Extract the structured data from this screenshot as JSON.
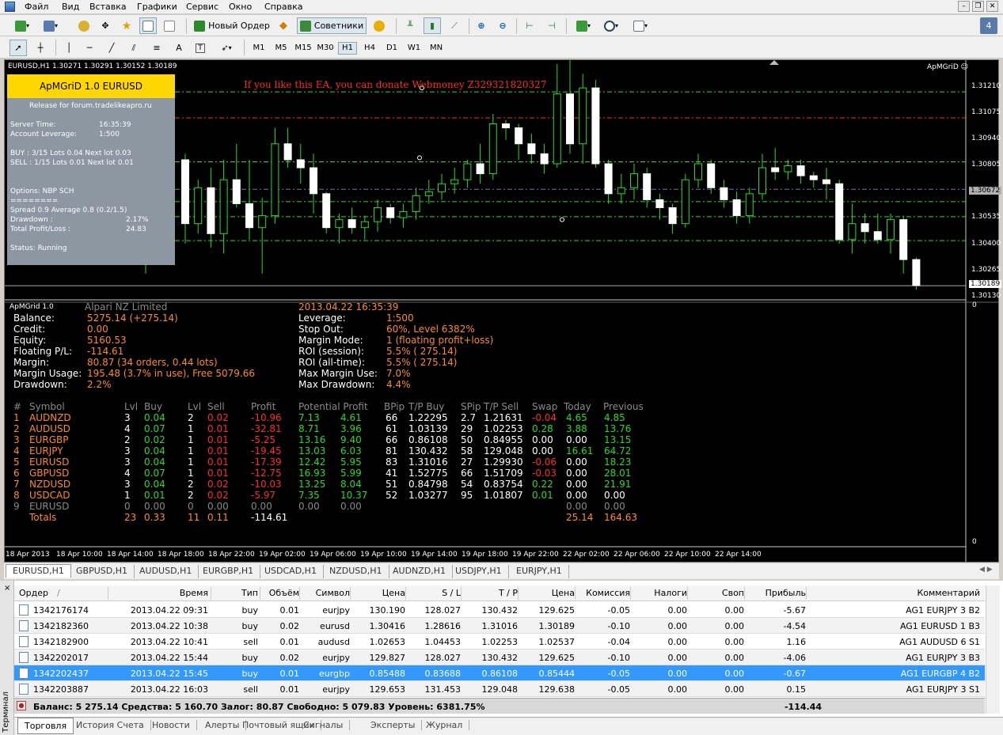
{
  "menu": {
    "items": [
      "Файл",
      "Вид",
      "Вставка",
      "Графики",
      "Сервис",
      "Окно",
      "Справка"
    ]
  },
  "toolbar": {
    "new_order": "Новый Ордер",
    "advisors": "Советники",
    "notify_count": "4",
    "timeframes": [
      "M1",
      "M5",
      "M15",
      "M30",
      "H1",
      "H4",
      "D1",
      "W1",
      "MN"
    ],
    "active_tf": "H1",
    "text_tool": "A",
    "label_tool": "T"
  },
  "chart": {
    "label": "EURUSD,H1  1.30271 1.30291 1.30152 1.30189",
    "brand": "ApMGriD ☺",
    "donate": "If you like this EA, you can donate Webmoney Z329321820327",
    "price_axis": [
      "1.31210",
      "1.31075",
      "1.30940",
      "1.30805",
      "1.30672",
      "1.30535",
      "1.30400",
      "1.30265",
      "1.30189",
      "1.30130"
    ],
    "current_price": "1.30672",
    "last_price": "1.30189",
    "time_axis": [
      "18 Apr 2013",
      "18 Apr 10:00",
      "18 Apr 14:00",
      "18 Apr 18:00",
      "18 Apr 22:00",
      "19 Apr 02:00",
      "19 Apr 06:00",
      "19 Apr 10:00",
      "19 Apr 14:00",
      "19 Apr 18:00",
      "19 Apr 22:00",
      "22 Apr 02:00",
      "22 Apr 06:00",
      "22 Apr 10:00",
      "22 Apr 14:00"
    ],
    "sub_axis_top": "0",
    "sub_axis_bottom": "0",
    "candles": [
      [
        1.3082,
        1.3085,
        1.304,
        1.305
      ],
      [
        1.305,
        1.3072,
        1.3045,
        1.3068
      ],
      [
        1.3068,
        1.3078,
        1.3038,
        1.3045
      ],
      [
        1.3045,
        1.3082,
        1.3035,
        1.3072
      ],
      [
        1.3072,
        1.309,
        1.3058,
        1.306
      ],
      [
        1.306,
        1.3082,
        1.3042,
        1.3048
      ],
      [
        1.3048,
        1.3063,
        1.3025,
        1.3054
      ],
      [
        1.3054,
        1.3098,
        1.305,
        1.309
      ],
      [
        1.309,
        1.3098,
        1.3078,
        1.3082
      ],
      [
        1.3082,
        1.309,
        1.307,
        1.3078
      ],
      [
        1.3078,
        1.3085,
        1.3055,
        1.3065
      ],
      [
        1.3065,
        1.3066,
        1.3045,
        1.3048
      ],
      [
        1.3048,
        1.3055,
        1.304,
        1.3052
      ],
      [
        1.3052,
        1.3058,
        1.3045,
        1.3048
      ],
      [
        1.3048,
        1.3054,
        1.3042,
        1.3051
      ],
      [
        1.3051,
        1.3062,
        1.3046,
        1.3058
      ],
      [
        1.3058,
        1.306,
        1.305,
        1.3053
      ],
      [
        1.3053,
        1.306,
        1.3048,
        1.3056
      ],
      [
        1.3056,
        1.3068,
        1.3052,
        1.3064
      ],
      [
        1.3064,
        1.3072,
        1.306,
        1.3066
      ],
      [
        1.3066,
        1.3075,
        1.3062,
        1.307
      ],
      [
        1.307,
        1.3078,
        1.3065,
        1.3072
      ],
      [
        1.3072,
        1.3082,
        1.3068,
        1.308
      ],
      [
        1.308,
        1.309,
        1.307,
        1.3075
      ],
      [
        1.3075,
        1.3105,
        1.3072,
        1.31
      ],
      [
        1.31,
        1.3102,
        1.3092,
        1.3098
      ],
      [
        1.3098,
        1.31,
        1.3082,
        1.309
      ],
      [
        1.309,
        1.3095,
        1.308,
        1.3085
      ],
      [
        1.3085,
        1.309,
        1.3075,
        1.308
      ],
      [
        1.308,
        1.313,
        1.3078,
        1.3115
      ],
      [
        1.3115,
        1.3135,
        1.3085,
        1.309
      ],
      [
        1.309,
        1.3125,
        1.308,
        1.3118
      ],
      [
        1.3118,
        1.3122,
        1.3078,
        1.308
      ],
      [
        1.308,
        1.3082,
        1.306,
        1.3065
      ],
      [
        1.3065,
        1.3075,
        1.306,
        1.3068
      ],
      [
        1.3068,
        1.308,
        1.3062,
        1.3075
      ],
      [
        1.3075,
        1.3078,
        1.3058,
        1.3062
      ],
      [
        1.3062,
        1.3065,
        1.3052,
        1.3058
      ],
      [
        1.3058,
        1.306,
        1.3045,
        1.305
      ],
      [
        1.305,
        1.3075,
        1.3048,
        1.3072
      ],
      [
        1.3072,
        1.3085,
        1.3068,
        1.308
      ],
      [
        1.308,
        1.3082,
        1.3065,
        1.3068
      ],
      [
        1.3068,
        1.3072,
        1.3058,
        1.3062
      ],
      [
        1.3062,
        1.3066,
        1.305,
        1.3054
      ],
      [
        1.3054,
        1.3068,
        1.305,
        1.3065
      ],
      [
        1.3065,
        1.3085,
        1.3062,
        1.3078
      ],
      [
        1.3078,
        1.3088,
        1.3072,
        1.3076
      ],
      [
        1.3076,
        1.3082,
        1.3072,
        1.3079
      ],
      [
        1.3079,
        1.3082,
        1.307,
        1.3074
      ],
      [
        1.3074,
        1.3076,
        1.3068,
        1.3072
      ],
      [
        1.3072,
        1.3078,
        1.3062,
        1.307
      ],
      [
        1.307,
        1.3072,
        1.304,
        1.3042
      ],
      [
        1.3042,
        1.306,
        1.3035,
        1.305
      ],
      [
        1.305,
        1.3055,
        1.304,
        1.3046
      ],
      [
        1.3046,
        1.3055,
        1.304,
        1.3042
      ],
      [
        1.3042,
        1.3055,
        1.3035,
        1.3052
      ],
      [
        1.3052,
        1.3054,
        1.3025,
        1.3032
      ],
      [
        1.3032,
        1.3033,
        1.3017,
        1.3019
      ]
    ],
    "levels": [
      {
        "price": 1.3116,
        "color": "#22dd22",
        "style": "dash-dot"
      },
      {
        "price": 1.3103,
        "color": "#ff2a2a",
        "style": "dash-dot"
      },
      {
        "price": 1.3081,
        "color": "#22dd22",
        "style": "dash-dot"
      },
      {
        "price": 1.30672,
        "color": "#6677aa",
        "style": "dash-dot"
      },
      {
        "price": 1.3061,
        "color": "#22dd22",
        "style": "dash-dot"
      },
      {
        "price": 1.30535,
        "color": "#22dd22",
        "style": "dash-dot"
      },
      {
        "price": 1.30415,
        "color": "#22dd22",
        "style": "dash-dot"
      },
      {
        "price": 1.30189,
        "color": "#aaaaaa",
        "style": "solid"
      }
    ],
    "price_min": 1.3013,
    "price_max": 1.3124
  },
  "ea_panel": {
    "title": "ApMGriD 1.0 EURUSD",
    "release": "Release for forum.tradelikeapro.ru",
    "server_time_label": "Server Time:",
    "server_time": "16:35:39",
    "leverage_label": "Account Leverage:",
    "leverage": "1:500",
    "buy_line": "BUY : 3/15  Lots 0.04 Next lot 0.03",
    "sell_line": "SELL : 1/15  Lots 0.01 Next lot 0.01",
    "options": "Options: NBP SCH",
    "divider": "========",
    "spread": "Spread 0.9 Average 0.8 (0.2/1.5)",
    "drawdown_label": "Drawdown :",
    "drawdown": "2.17%",
    "pl_label": "Total Profit/Loss :",
    "pl": "24.83",
    "status": "Status: Running"
  },
  "stats": {
    "ea_name": "ApMGrid 1.0",
    "broker": "Alpari NZ Limited",
    "datetime": "2013.04.22 16:35:39",
    "left": [
      [
        "Balance:",
        "5275.14 (+275.14)"
      ],
      [
        "Credit:",
        "0.00"
      ],
      [
        "Equity:",
        "5160.53"
      ],
      [
        "Floating P/L:",
        "-114.61"
      ],
      [
        "Margin:",
        "80.87 (34 orders, 0.44 lots)"
      ],
      [
        "Margin Usage:",
        "195.48 (3.7% in use), Free 5079.66"
      ],
      [
        "Drawdown:",
        "2.2%"
      ]
    ],
    "right": [
      [
        "Leverage:",
        "1:500"
      ],
      [
        "Stop Out:",
        "60%, Level 6382%"
      ],
      [
        "Margin Mode:",
        "1 (floating profit+loss)"
      ],
      [
        "ROI (session):",
        "5.5% ( 275.14)"
      ],
      [
        "ROI (all-time):",
        "5.5% ( 275.14)"
      ],
      [
        "Max Margin Use:",
        "7.0%"
      ],
      [
        "Max Drawdown:",
        "4.4%"
      ]
    ]
  },
  "symtable": {
    "headers": [
      "#",
      "Symbol",
      "Lvl",
      "Buy",
      "Lvl",
      "Sell",
      "Profit",
      "Potential Profit",
      "BPip",
      "T/P Buy",
      "SPip",
      "T/P Sell",
      "Swap",
      "Today",
      "Previous"
    ],
    "rows": [
      [
        "1",
        "AUDNZD",
        "3",
        "0.04",
        "2",
        "0.02",
        "-10.96",
        "7.13",
        "4.61",
        "66",
        "1.22295",
        "2.7",
        "1.21631",
        "-0.04",
        "4.65",
        "4.85"
      ],
      [
        "2",
        "AUDUSD",
        "4",
        "0.07",
        "1",
        "0.01",
        "-32.81",
        "8.71",
        "3.96",
        "61",
        "1.03139",
        "29",
        "1.02253",
        "0.28",
        "3.88",
        "13.76"
      ],
      [
        "3",
        "EURGBP",
        "2",
        "0.02",
        "1",
        "0.01",
        "-5.25",
        "13.16",
        "9.40",
        "66",
        "0.86108",
        "50",
        "0.84955",
        "0.00",
        "0.00",
        "13.15"
      ],
      [
        "4",
        "EURJPY",
        "3",
        "0.04",
        "1",
        "0.01",
        "-19.45",
        "13.03",
        "6.03",
        "81",
        "130.432",
        "58",
        "129.048",
        "0.00",
        "16.61",
        "64.72"
      ],
      [
        "5",
        "EURUSD",
        "3",
        "0.04",
        "1",
        "0.01",
        "-17.39",
        "12.42",
        "5.95",
        "83",
        "1.31016",
        "27",
        "1.29930",
        "-0.06",
        "0.00",
        "18.23"
      ],
      [
        "6",
        "GBPUSD",
        "4",
        "0.07",
        "1",
        "0.01",
        "-12.75",
        "16.93",
        "5.99",
        "41",
        "1.52775",
        "66",
        "1.51709",
        "-0.03",
        "0.00",
        "28.01"
      ],
      [
        "7",
        "NZDUSD",
        "3",
        "0.04",
        "2",
        "0.02",
        "-10.03",
        "13.25",
        "8.04",
        "51",
        "0.84798",
        "54",
        "0.83754",
        "0.22",
        "0.00",
        "21.91"
      ],
      [
        "8",
        "USDCAD",
        "1",
        "0.01",
        "2",
        "0.02",
        "-5.97",
        "7.35",
        "10.37",
        "52",
        "1.03277",
        "95",
        "1.01807",
        "0.01",
        "0.00",
        "0.00"
      ],
      [
        "9",
        "EURUSD",
        "0",
        "0.00",
        "0",
        "0.00",
        "0.00",
        "0.00",
        "0.00",
        "",
        "",
        "",
        "",
        "",
        "0.00",
        "0.00"
      ]
    ],
    "totals": {
      "label": "Totals",
      "lvl_buy": "23",
      "buy": "0.33",
      "lvl_sell": "11",
      "sell": "0.11",
      "profit": "-114.61",
      "today": "25.14",
      "previous": "164.63"
    }
  },
  "symbol_tabs": [
    "EURUSD,H1",
    "GBPUSD,H1",
    "AUDUSD,H1",
    "EURGBP,H1",
    "USDCAD,H1",
    "NZDUSD,H1",
    "AUDNZD,H1",
    "USDJPY,H1",
    "EURJPY,H1"
  ],
  "orders": {
    "headers": [
      "Ордер",
      "Время",
      "Тип",
      "Объём",
      "Символ",
      "Цена",
      "S / L",
      "T / P",
      "Цена",
      "Комиссия",
      "Налоги",
      "Своп",
      "Прибыль",
      "Комментарий"
    ],
    "sort_mark": "/",
    "rows": [
      [
        "1342176174",
        "2013.04.22 09:31",
        "buy",
        "0.01",
        "eurjpy",
        "130.190",
        "128.027",
        "130.432",
        "129.625",
        "-0.05",
        "0.00",
        "0.00",
        "-5.67",
        "AG1 EURJPY 3 B2"
      ],
      [
        "1342182360",
        "2013.04.22 10:38",
        "buy",
        "0.02",
        "eurusd",
        "1.30416",
        "1.28616",
        "1.31016",
        "1.30189",
        "-0.10",
        "0.00",
        "0.00",
        "-4.54",
        "AG1 EURUSD 1 B3"
      ],
      [
        "1342182900",
        "2013.04.22 10:41",
        "sell",
        "0.01",
        "audusd",
        "1.02653",
        "1.04453",
        "1.02253",
        "1.02537",
        "-0.04",
        "0.00",
        "0.00",
        "1.16",
        "AG1 AUDUSD 6 S1"
      ],
      [
        "1342202017",
        "2013.04.22 15:44",
        "buy",
        "0.02",
        "eurjpy",
        "129.827",
        "128.027",
        "130.432",
        "129.625",
        "-0.10",
        "0.00",
        "0.00",
        "-4.06",
        "AG1 EURJPY 3 B3"
      ],
      [
        "1342202437",
        "2013.04.22 15:45",
        "buy",
        "0.01",
        "eurgbp",
        "0.85488",
        "0.83688",
        "0.86108",
        "0.85444",
        "-0.05",
        "0.00",
        "0.00",
        "-0.67",
        "AG1 EURGBP 4 B2"
      ],
      [
        "1342203887",
        "2013.04.22 16:03",
        "sell",
        "0.01",
        "eurjpy",
        "129.653",
        "131.453",
        "129.048",
        "129.638",
        "-0.05",
        "0.00",
        "0.00",
        "0.15",
        "AG1 EURJPY 3 S1"
      ]
    ],
    "selected_index": 4,
    "balance_line": "Баланс: 5 275.14  Средства: 5 160.70  Залог: 80.87  Свободно: 5 079.83  Уровень: 6381.75%",
    "balance_profit": "-114.44"
  },
  "terminal": {
    "side_label": "Терминал",
    "close": "×",
    "tabs": [
      "Торговля",
      "История Счета",
      "Новости",
      "Алерты",
      "Почтовый ящик",
      "Сигналы",
      "Эксперты",
      "Журнал"
    ],
    "active_tab": 0
  }
}
